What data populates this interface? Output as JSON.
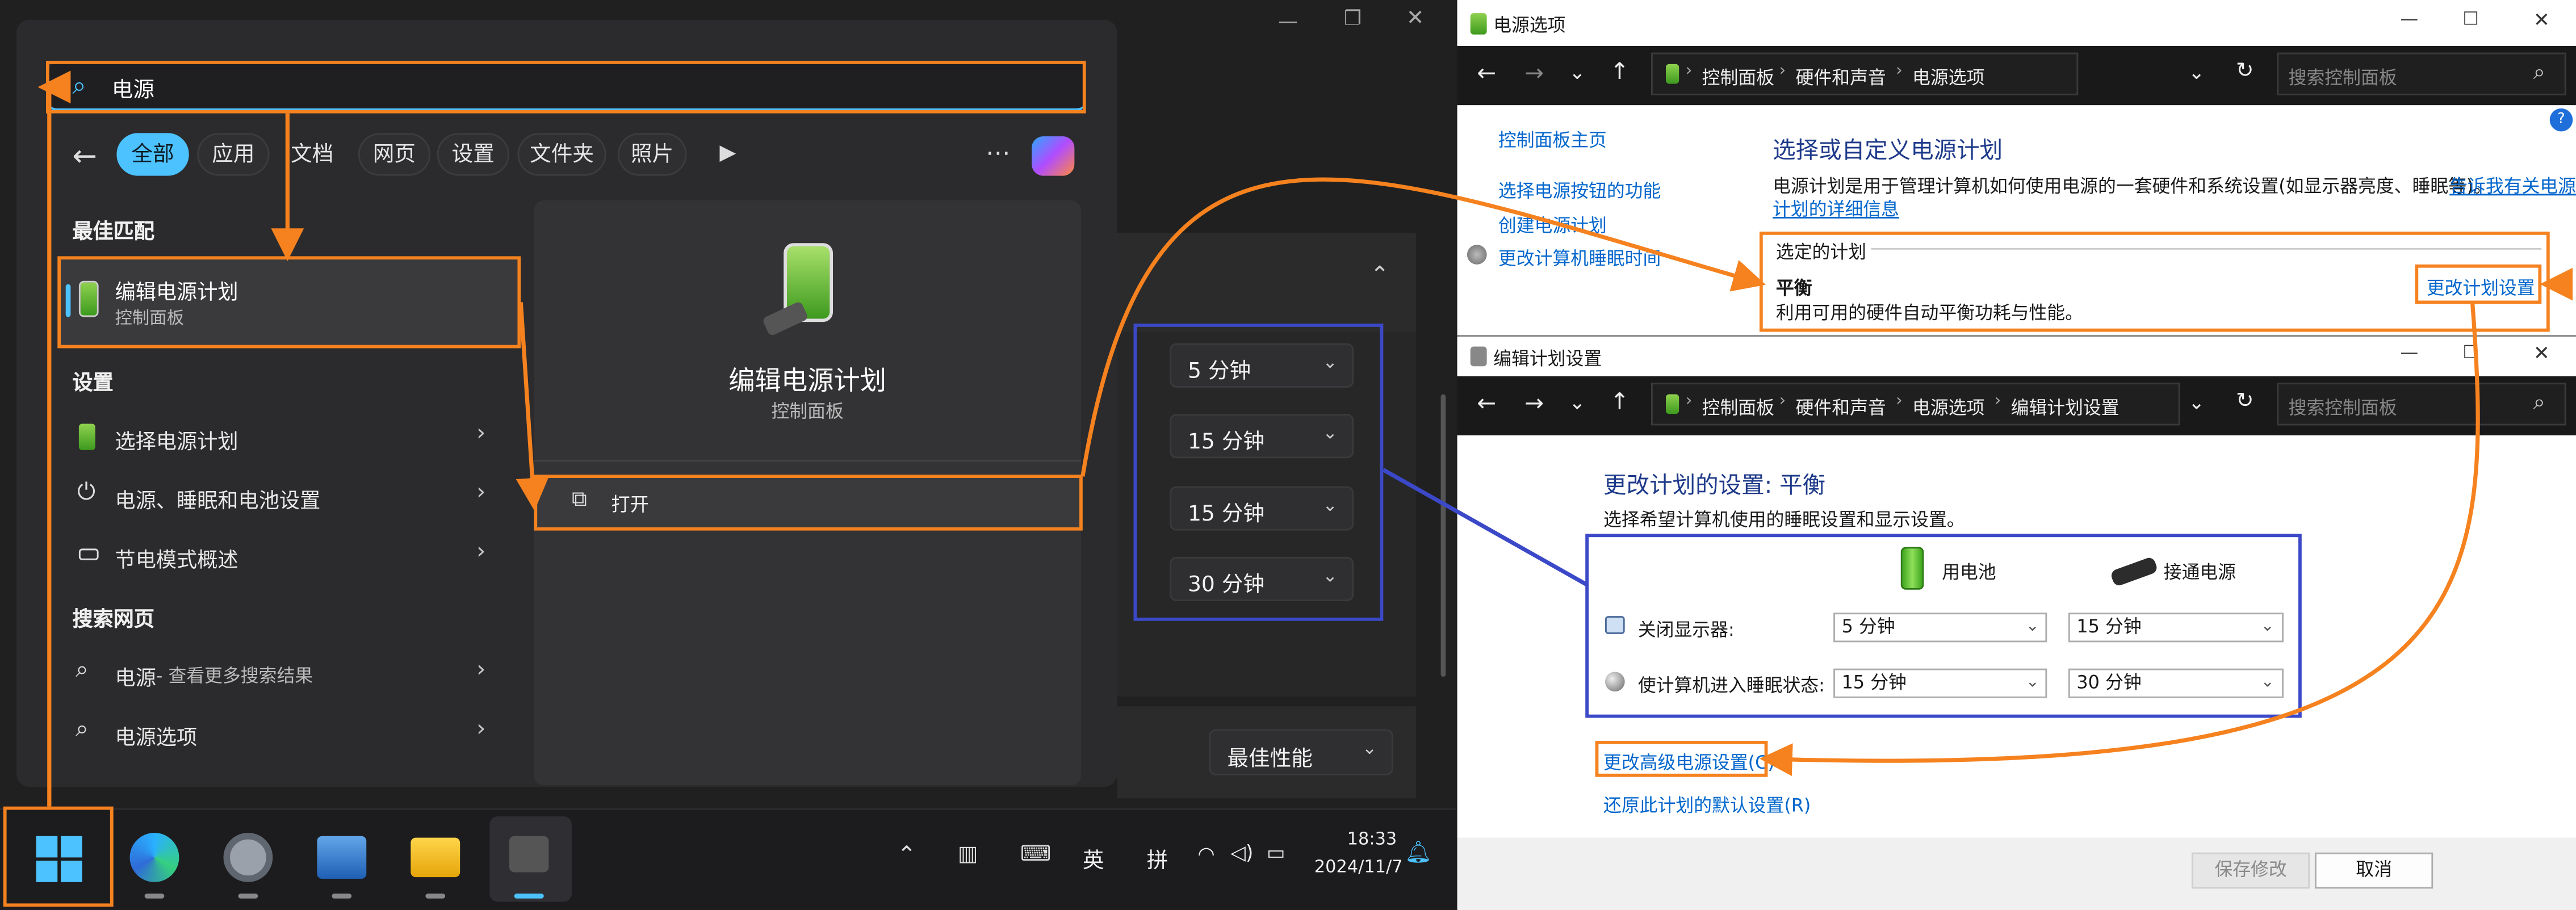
{
  "colors": {
    "accent_orange": "#f5821f",
    "accent_blue": "#3b49c8",
    "win_accent": "#4cc2ff",
    "link": "#0066cc"
  },
  "start_menu": {
    "search_value": "电源",
    "filters": [
      "全部",
      "应用",
      "文档",
      "网页",
      "设置",
      "文件夹",
      "照片"
    ],
    "best_match_heading": "最佳匹配",
    "best_match": {
      "title": "编辑电源计划",
      "subtitle": "控制面板"
    },
    "settings_heading": "设置",
    "settings_items": [
      "选择电源计划",
      "电源、睡眠和电池设置",
      "节电模式概述"
    ],
    "web_heading": "搜索网页",
    "web_items": [
      {
        "label": "电源",
        "suffix": " - 查看更多搜索结果"
      },
      {
        "label": "电源选项",
        "suffix": ""
      }
    ],
    "preview": {
      "title": "编辑电源计划",
      "subtitle": "控制面板",
      "open_label": "打开"
    }
  },
  "settings_panel": {
    "dropdowns": [
      "5 分钟",
      "15 分钟",
      "15 分钟",
      "30 分钟"
    ],
    "performance_value": "最佳性能"
  },
  "taskbar": {
    "time": "18:33",
    "date": "2024/11/7",
    "ime_lang": "英",
    "ime_mode": "拼"
  },
  "power_options_window": {
    "title": "电源选项",
    "breadcrumb": [
      "控制面板",
      "硬件和声音",
      "电源选项"
    ],
    "search_placeholder": "搜索控制面板",
    "sidebar": [
      "控制面板主页",
      "选择电源按钮的功能",
      "创建电源计划",
      "更改计算机睡眠时间"
    ],
    "heading": "选择或自定义电源计划",
    "description": "电源计划是用于管理计算机如何使用电源的一套硬件和系统设置(如显示器亮度、睡眠等)。",
    "more_link_1": "告诉我有关电源",
    "more_link_2": "计划的详细信息",
    "selected_plan_label": "选定的计划",
    "plan_name": "平衡",
    "plan_desc": "利用可用的硬件自动平衡功耗与性能。",
    "change_plan_link": "更改计划设置"
  },
  "edit_plan_window": {
    "title": "编辑计划设置",
    "breadcrumb": [
      "控制面板",
      "硬件和声音",
      "电源选项",
      "编辑计划设置"
    ],
    "search_placeholder": "搜索控制面板",
    "heading": "更改计划的设置: 平衡",
    "subheading": "选择希望计算机使用的睡眠设置和显示设置。",
    "col_battery": "用电池",
    "col_plugged": "接通电源",
    "rows": [
      {
        "label": "关闭显示器:",
        "battery": "5 分钟",
        "plugged": "15 分钟"
      },
      {
        "label": "使计算机进入睡眠状态:",
        "battery": "15 分钟",
        "plugged": "30 分钟"
      }
    ],
    "advanced_link": "更改高级电源设置(C)",
    "restore_link": "还原此计划的默认设置(R)",
    "save_button": "保存修改",
    "cancel_button": "取消"
  }
}
